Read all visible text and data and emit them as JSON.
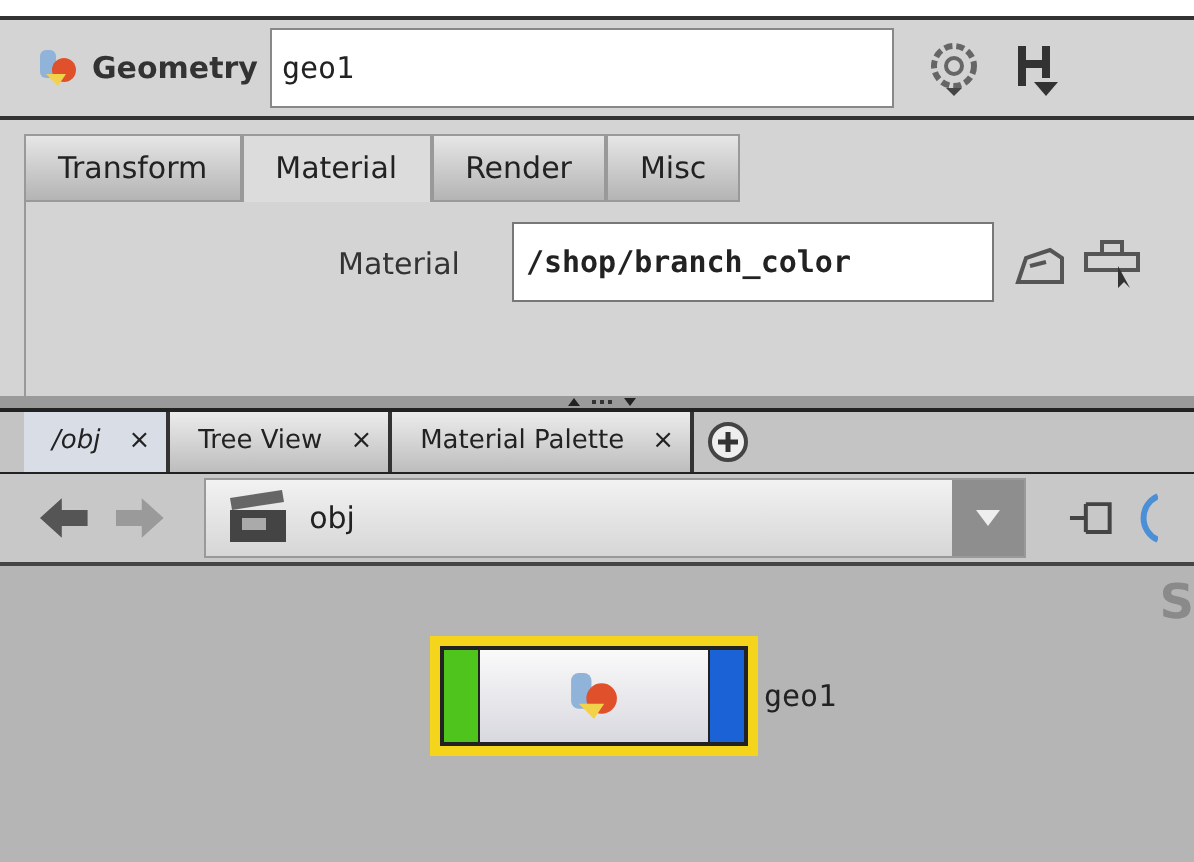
{
  "header": {
    "type_label": "Geometry",
    "name_value": "geo1"
  },
  "tabs": [
    {
      "label": "Transform",
      "selected": false
    },
    {
      "label": "Material",
      "selected": true
    },
    {
      "label": "Render",
      "selected": false
    },
    {
      "label": "Misc",
      "selected": false
    }
  ],
  "material": {
    "label": "Material",
    "value": "/shop/branch_color"
  },
  "pane_tabs": [
    {
      "label": "/obj",
      "selected": true
    },
    {
      "label": "Tree View",
      "selected": false
    },
    {
      "label": "Material Palette",
      "selected": false
    }
  ],
  "close_mark": "×",
  "path": {
    "value": "obj"
  },
  "network": {
    "corner_text": "S",
    "nodes": [
      {
        "name": "geo1",
        "selected": true
      }
    ]
  }
}
